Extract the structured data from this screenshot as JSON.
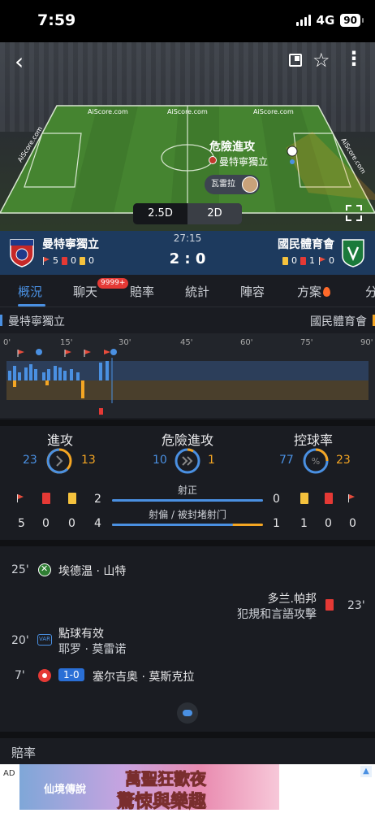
{
  "status": {
    "time": "7:59",
    "network": "4G",
    "battery": "90"
  },
  "pitch": {
    "watermark": "AiScore.com",
    "danger_title": "危險進攻",
    "danger_team": "曼特寧獨立",
    "player_name": "瓦雷拉",
    "view_options": [
      "2.5D",
      "2D"
    ],
    "selected_view": "2.5D"
  },
  "match": {
    "home": {
      "name": "曼特寧獨立",
      "corners": "5",
      "red": "0",
      "yellow": "0"
    },
    "away": {
      "name": "國民體育會",
      "yellow": "0",
      "red": "1",
      "corners": "0"
    },
    "time": "27:15",
    "score": "2 : 0"
  },
  "tabs": [
    {
      "label": "概況"
    },
    {
      "label": "聊天"
    },
    {
      "label": "賠率"
    },
    {
      "label": "統計"
    },
    {
      "label": "陣容"
    },
    {
      "label": "方案"
    },
    {
      "label": "分"
    }
  ],
  "chat_badge": "9999+",
  "timeline": {
    "home_name": "曼特寧獨立",
    "away_name": "國民體育會",
    "ticks": [
      "0'",
      "15'",
      "30'",
      "45'",
      "60'",
      "75'",
      "90'"
    ]
  },
  "stats": {
    "attack": {
      "label": "進攻",
      "home": "23",
      "away": "13"
    },
    "dangerous": {
      "label": "危險進攻",
      "home": "10",
      "away": "1"
    },
    "possession": {
      "label": "控球率",
      "home": "77",
      "away": "23",
      "symbol": "%"
    },
    "shots_on": {
      "label": "射正",
      "home": "2",
      "away": "0"
    },
    "shots_off": {
      "label": "射偏 / 被封堵射门",
      "home": "4",
      "away": "1"
    },
    "home_counts": {
      "corners": "5",
      "red": "0",
      "yellow": "0"
    },
    "away_counts": {
      "yellow": "1",
      "red": "0",
      "corners": "0"
    }
  },
  "events": [
    {
      "minute": "25'",
      "text": "埃德温 · 山特",
      "type": "substitution"
    },
    {
      "minute": "23'",
      "text": "多兰.帕邦",
      "subtext": "犯規和言語攻擊",
      "type": "red-card"
    },
    {
      "minute": "20'",
      "text": "點球有效",
      "subtext": "耶罗 · 莫雷诺",
      "type": "var"
    },
    {
      "minute": "7'",
      "text": "塞尔吉奥 · 莫斯克拉",
      "score": "1-0",
      "type": "goal"
    }
  ],
  "var_label": "VAR",
  "odds_title": "賠率",
  "ad": {
    "label": "AD",
    "line1": "萬聖狂歡夜",
    "line2": "驚悚與樂趣",
    "brand": "仙境傳說"
  },
  "colors": {
    "home": "#4a90e2",
    "away": "#f5a623",
    "scoreboard": "#1d3a5e"
  }
}
